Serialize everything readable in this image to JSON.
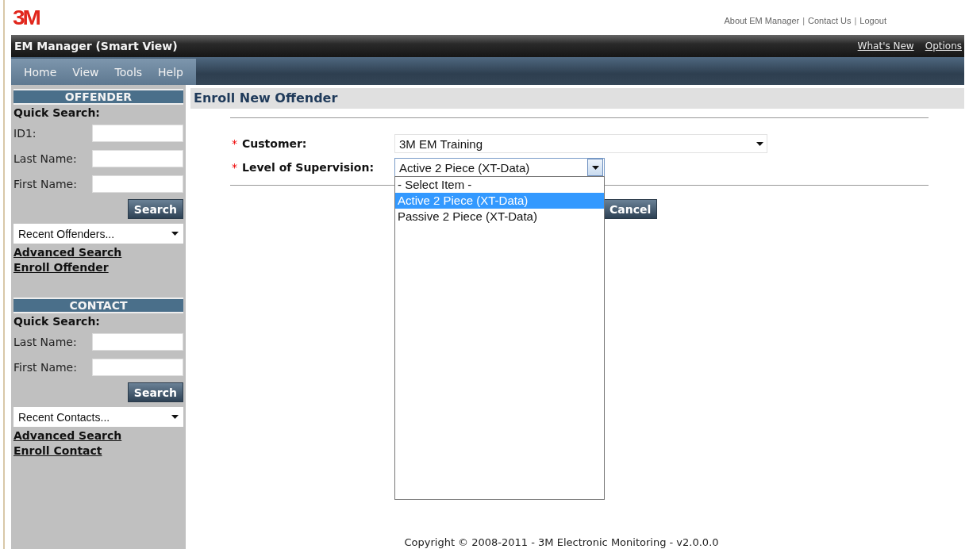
{
  "header": {
    "logo": "3M",
    "links": [
      "About EM Manager",
      "Contact Us",
      "Logout"
    ],
    "separator": "|"
  },
  "title_bar": {
    "title": "EM Manager (Smart View)",
    "links": [
      "What's New",
      "Options"
    ]
  },
  "menu": [
    "Home",
    "View",
    "Tools",
    "Help"
  ],
  "sidebar": [
    {
      "heading": "OFFENDER",
      "quick_search": "Quick Search:",
      "fields": [
        {
          "label": "ID1:"
        },
        {
          "label": "Last Name:"
        },
        {
          "label": "First Name:"
        }
      ],
      "search_button": "Search",
      "recent": "Recent Offenders...",
      "links": [
        "Advanced Search",
        "Enroll Offender"
      ]
    },
    {
      "heading": "CONTACT",
      "quick_search": "Quick Search:",
      "fields": [
        {
          "label": "Last Name:"
        },
        {
          "label": "First Name:"
        }
      ],
      "search_button": "Search",
      "recent": "Recent Contacts...",
      "links": [
        "Advanced Search",
        "Enroll Contact"
      ]
    }
  ],
  "main": {
    "heading": "Enroll New Offender",
    "fields": [
      {
        "label": "Customer:",
        "marker": "*",
        "value": "3M EM Training",
        "expanded": false,
        "kind": "wide"
      },
      {
        "label": "Level of Supervision:",
        "marker": "*",
        "value": "Active 2 Piece (XT-Data)",
        "expanded": true,
        "kind": "narrow",
        "options": [
          {
            "label": "- Select Item -",
            "selected": false
          },
          {
            "label": "Active 2 Piece (XT-Data)",
            "selected": true
          },
          {
            "label": "Passive 2 Piece (XT-Data)",
            "selected": false
          }
        ]
      }
    ],
    "buttons": [
      "Cancel"
    ]
  },
  "footer": "Copyright © 2008-2011 - 3M Electronic Monitoring - v2.0.0.0"
}
